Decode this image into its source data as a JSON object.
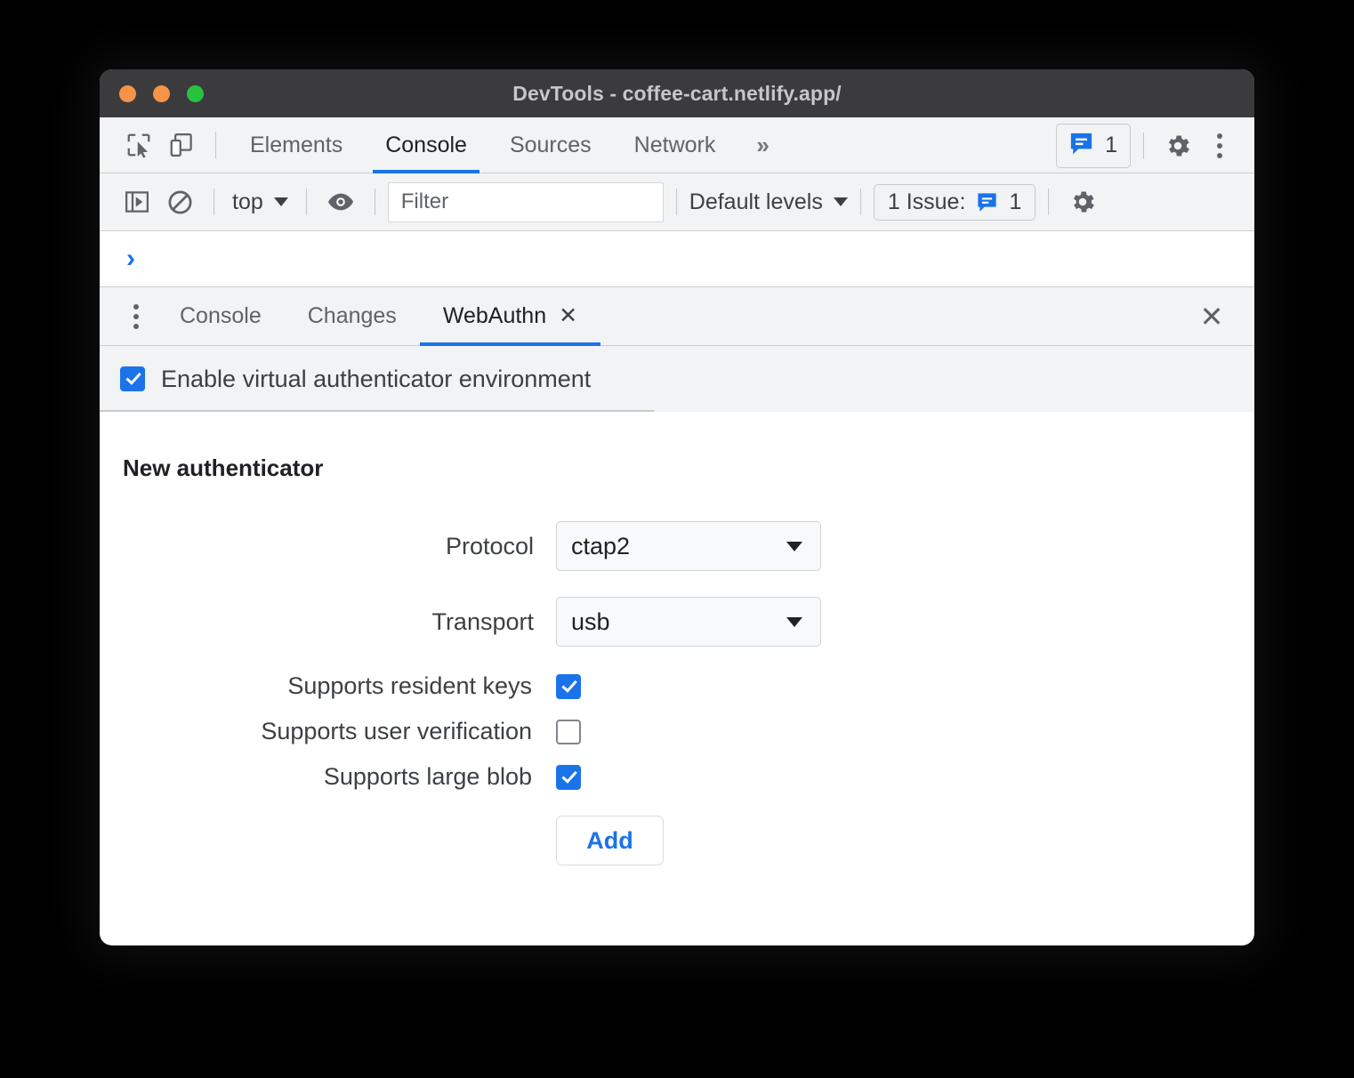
{
  "window": {
    "title": "DevTools - coffee-cart.netlify.app/",
    "traffic_lights": [
      "close",
      "minimize",
      "maximize"
    ]
  },
  "main_tabs": {
    "inspect_icon": "inspect-element-icon",
    "device_icon": "device-toolbar-icon",
    "items": [
      {
        "label": "Elements",
        "active": false
      },
      {
        "label": "Console",
        "active": true
      },
      {
        "label": "Sources",
        "active": false
      },
      {
        "label": "Network",
        "active": false
      }
    ],
    "more_label": "»",
    "issues_badge": {
      "icon": "issues-message-icon",
      "count": "1"
    },
    "settings_icon": "gear-icon",
    "menu_icon": "kebab-menu-icon"
  },
  "console_toolbar": {
    "sidebar_toggle_icon": "console-sidebar-icon",
    "clear_icon": "clear-console-icon",
    "context_label": "top",
    "eye_icon": "live-expression-eye-icon",
    "filter_placeholder": "Filter",
    "filter_value": "",
    "levels_label": "Default levels",
    "issue_label": "1 Issue:",
    "issue_count": "1",
    "settings_icon": "gear-icon"
  },
  "console_body": {
    "prompt": "›"
  },
  "drawer": {
    "menu_icon": "drawer-kebab-icon",
    "tabs": [
      {
        "label": "Console",
        "active": false,
        "closable": false
      },
      {
        "label": "Changes",
        "active": false,
        "closable": false
      },
      {
        "label": "WebAuthn",
        "active": true,
        "closable": true,
        "close_glyph": "✕"
      }
    ],
    "close_glyph": "✕"
  },
  "webauthn": {
    "enable_label": "Enable virtual authenticator environment",
    "enable_checked": true,
    "section_title": "New authenticator",
    "fields": [
      {
        "label": "Protocol",
        "value": "ctap2",
        "type": "select"
      },
      {
        "label": "Transport",
        "value": "usb",
        "type": "select"
      }
    ],
    "options": [
      {
        "label": "Supports resident keys",
        "checked": true
      },
      {
        "label": "Supports user verification",
        "checked": false
      },
      {
        "label": "Supports large blob",
        "checked": true
      }
    ],
    "add_label": "Add"
  },
  "colors": {
    "accent_blue": "#1a73e8",
    "titlebar": "#3b3b3d",
    "toolbar_bg": "#f1f3f4",
    "traffic_orange": "#f79347",
    "traffic_green": "#29c23f"
  }
}
